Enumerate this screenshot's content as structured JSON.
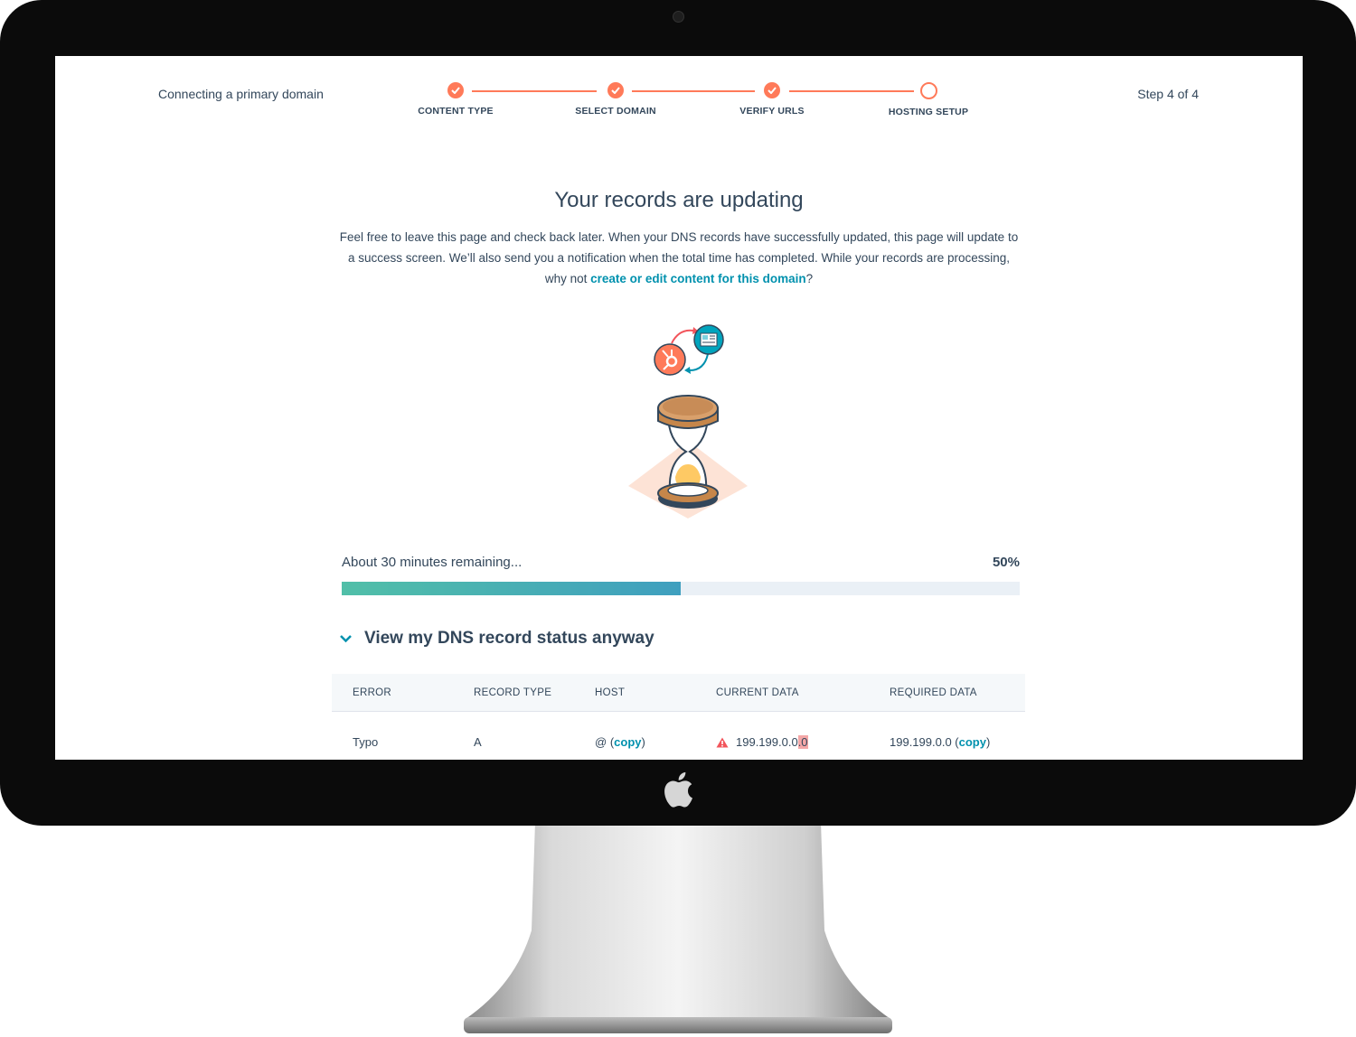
{
  "header": {
    "breadcrumb": "Connecting a primary domain",
    "step_count": "Step 4 of 4",
    "steps": [
      {
        "label": "CONTENT TYPE",
        "done": true
      },
      {
        "label": "SELECT DOMAIN",
        "done": true
      },
      {
        "label": "VERIFY URLS",
        "done": true
      },
      {
        "label": "HOSTING SETUP",
        "done": false
      }
    ]
  },
  "main": {
    "title": "Your records are updating",
    "desc_line1": "Feel free to leave this page and check back later. When your DNS records have successfully updated, this page will update to",
    "desc_line2": "a success screen. We’ll also send you a notification when the total time has completed. While your records are processing,",
    "desc_line3_prefix": "why not ",
    "desc_link": "create or edit content for this domain",
    "desc_line3_suffix": "?"
  },
  "progress": {
    "text": "About 30 minutes remaining...",
    "percent_label": "50%",
    "value": 0.5
  },
  "dns": {
    "toggle_label": "View my DNS record status anyway",
    "columns": [
      "ERROR",
      "RECORD TYPE",
      "HOST",
      "CURRENT DATA",
      "REQUIRED DATA"
    ],
    "rows": [
      {
        "error": "Typo",
        "record_type": "A",
        "host": "@",
        "host_copy": "copy",
        "current_data_main": "199.199.0.0",
        "current_data_highlight": ".0",
        "required_data": "199.199.0.0",
        "required_copy": "copy"
      }
    ]
  },
  "colors": {
    "accent": "#ff7a59",
    "link": "#0091ae",
    "text": "#33475b",
    "progress_start": "#51bfa8",
    "progress_end": "#3f9fbf"
  }
}
